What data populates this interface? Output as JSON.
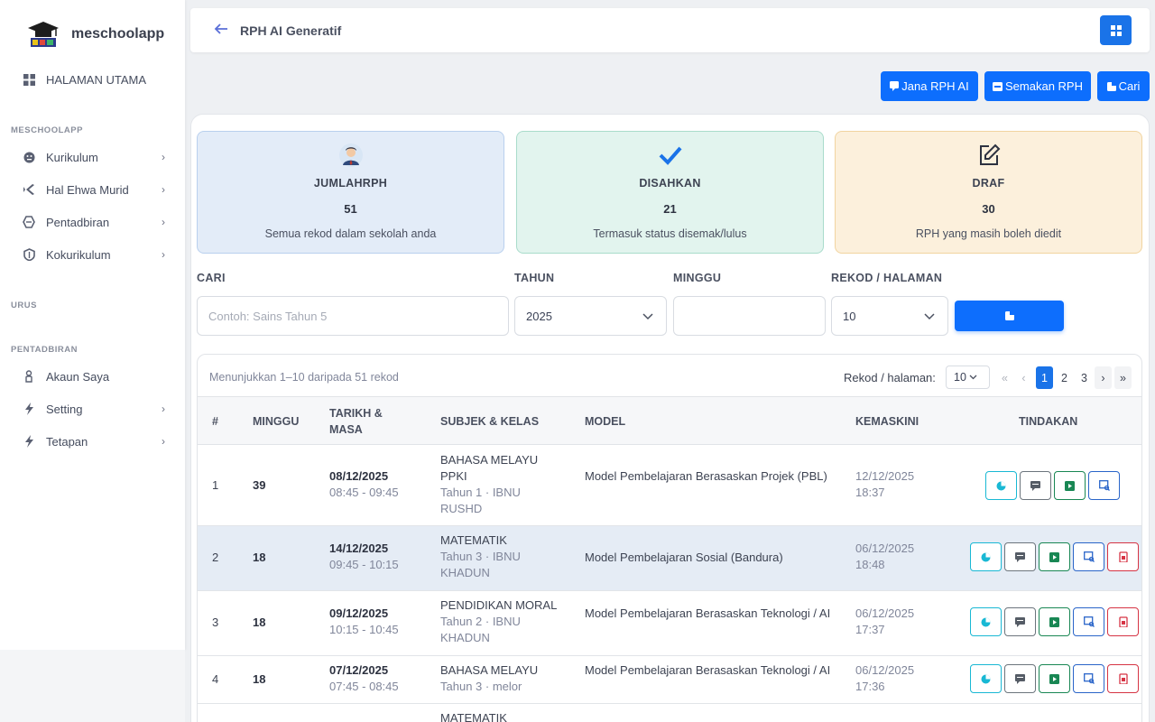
{
  "brand": {
    "name": "meschoolapp"
  },
  "sidebar": {
    "home": {
      "label": "HALAMAN UTAMA",
      "icon": "grid-icon"
    },
    "section1": "MESCHOOLAPP",
    "items1": [
      {
        "label": "Kurikulum",
        "icon": "face-icon"
      },
      {
        "label": "Hal Ehwa Murid",
        "icon": "code-icon"
      },
      {
        "label": "Pentadbiran",
        "icon": "chip-icon"
      },
      {
        "label": "Kokurikulum",
        "icon": "shield-icon"
      }
    ],
    "section2": "URUS",
    "section3": "PENTADBIRAN",
    "items3": [
      {
        "label": "Akaun Saya",
        "icon": "user-icon"
      },
      {
        "label": "Setting",
        "icon": "bolt-icon"
      },
      {
        "label": "Tetapan",
        "icon": "bolt-icon"
      }
    ]
  },
  "topbar": {
    "title": "RPH AI Generatif"
  },
  "actions": {
    "generate": "Jana RPH AI",
    "review": "Semakan RPH",
    "search": "Cari"
  },
  "stats": [
    {
      "label": "JUMLAHRPH",
      "value": "51",
      "desc": "Semua rekod dalam sekolah anda"
    },
    {
      "label": "DISAHKAN",
      "value": "21",
      "desc": "Termasuk status disemak/lulus"
    },
    {
      "label": "DRAF",
      "value": "30",
      "desc": "RPH yang masih boleh diedit"
    }
  ],
  "filters": {
    "search_label": "CARI",
    "search_placeholder": "Contoh: Sains Tahun 5",
    "year_label": "TAHUN",
    "year_value": "2025",
    "week_label": "MINGGU",
    "week_value": "",
    "perpage_label": "REKOD / HALAMAN",
    "perpage_value": "10"
  },
  "table": {
    "showing": "Menunjukkan 1–10 daripada 51 rekod",
    "perpage_label": "Rekod / halaman:",
    "perpage_value": "10",
    "pages": [
      "«",
      "‹",
      "1",
      "2",
      "3",
      "›",
      "»"
    ],
    "headers": {
      "num": "#",
      "week": "MINGGU",
      "date": "TARIKH &",
      "date2": "MASA",
      "subject": "SUBJEK & KELAS",
      "model": "MODEL",
      "updated": "KEMASKINI",
      "actions": "TINDAKAN"
    },
    "rows": [
      {
        "num": "1",
        "week": "39",
        "date": "08/12/2025",
        "time": "08:45 - 09:45",
        "subject": "BAHASA MELAYU PPKI",
        "class": "Tahun 1 · IBNU RUSHD",
        "model": "Model Pembelajaran Berasaskan Projek (PBL)",
        "updated_date": "12/12/2025",
        "updated_time": "18:37"
      },
      {
        "num": "2",
        "week": "18",
        "date": "14/12/2025",
        "time": "09:45 - 10:15",
        "subject": "MATEMATIK",
        "class": "Tahun 3 · IBNU KHADUN",
        "model": "Model Pembelajaran Sosial (Bandura)",
        "updated_date": "06/12/2025",
        "updated_time": "18:48"
      },
      {
        "num": "3",
        "week": "18",
        "date": "09/12/2025",
        "time": "10:15 - 10:45",
        "subject": "PENDIDIKAN MORAL",
        "class": "Tahun 2 · IBNU KHADUN",
        "model": "Model Pembelajaran Berasaskan Teknologi / AI",
        "updated_date": "06/12/2025",
        "updated_time": "17:37"
      },
      {
        "num": "4",
        "week": "18",
        "date": "07/12/2025",
        "time": "07:45 - 08:45",
        "subject": "BAHASA MELAYU",
        "class": "Tahun 3 · melor",
        "model": "Model Pembelajaran Berasaskan Teknologi / AI",
        "updated_date": "06/12/2025",
        "updated_time": "17:36"
      },
      {
        "num": "",
        "week": "",
        "date": "",
        "time": "",
        "subject": "MATEMATIK",
        "class": "",
        "model": "",
        "updated_date": "",
        "updated_time": ""
      }
    ]
  },
  "colors": {
    "primary": "#0d6efd",
    "info": "#19b8d4",
    "success": "#198754",
    "danger": "#d63444"
  }
}
